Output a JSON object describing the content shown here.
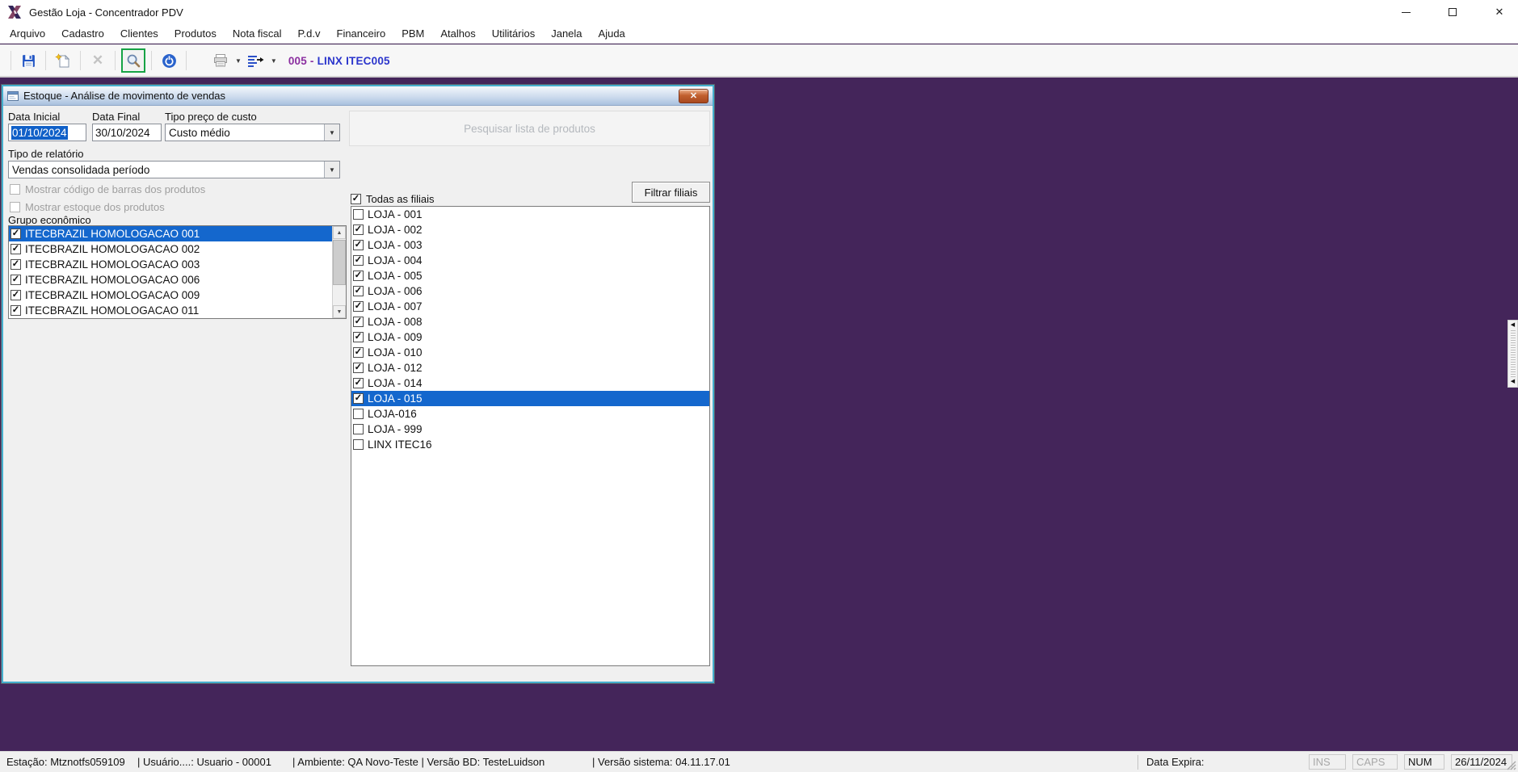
{
  "window": {
    "title": "Gestão Loja - Concentrador PDV"
  },
  "menu": {
    "items": [
      "Arquivo",
      "Cadastro",
      "Clientes",
      "Produtos",
      "Nota fiscal",
      "P.d.v",
      "Financeiro",
      "PBM",
      "Atalhos",
      "Utilitários",
      "Janela",
      "Ajuda"
    ]
  },
  "toolbar": {
    "store_prefix": "005 - ",
    "store_name": "LINX ITEC005"
  },
  "dialog": {
    "title": "Estoque - Análise de movimento de vendas",
    "fields": {
      "data_inicial": {
        "label": "Data Inicial",
        "value": "01/10/2024"
      },
      "data_final": {
        "label": "Data Final",
        "value": "30/10/2024"
      },
      "tipo_preco": {
        "label": "Tipo preço de custo",
        "value": "Custo médio"
      },
      "tipo_relatorio": {
        "label": "Tipo de relatório",
        "value": "Vendas consolidada período"
      }
    },
    "buttons": {
      "pesquisar": "Pesquisar lista de produtos",
      "filtrar": "Filtrar filiais"
    },
    "checkboxes": {
      "mostrar_codigo": {
        "label": "Mostrar código de barras dos produtos",
        "checked": false
      },
      "mostrar_estoque": {
        "label": "Mostrar estoque dos produtos",
        "checked": false
      },
      "todas_filiais": {
        "label": "Todas as filiais",
        "checked": true
      }
    },
    "grupo_economico": {
      "label": "Grupo econômico",
      "items": [
        {
          "label": "ITECBRAZIL HOMOLOGACAO 001",
          "checked": true,
          "selected": true
        },
        {
          "label": "ITECBRAZIL HOMOLOGACAO 002",
          "checked": true
        },
        {
          "label": "ITECBRAZIL HOMOLOGACAO 003",
          "checked": true
        },
        {
          "label": "ITECBRAZIL HOMOLOGACAO 006",
          "checked": true
        },
        {
          "label": "ITECBRAZIL HOMOLOGACAO 009",
          "checked": true
        },
        {
          "label": "ITECBRAZIL HOMOLOGACAO 011",
          "checked": true
        }
      ]
    },
    "filiais": {
      "items": [
        {
          "label": "LOJA - 001",
          "checked": false
        },
        {
          "label": "LOJA - 002",
          "checked": true
        },
        {
          "label": "LOJA - 003",
          "checked": true
        },
        {
          "label": "LOJA - 004",
          "checked": true
        },
        {
          "label": "LOJA - 005",
          "checked": true
        },
        {
          "label": "LOJA - 006",
          "checked": true
        },
        {
          "label": "LOJA - 007",
          "checked": true
        },
        {
          "label": "LOJA - 008",
          "checked": true
        },
        {
          "label": "LOJA - 009",
          "checked": true
        },
        {
          "label": "LOJA - 010",
          "checked": true
        },
        {
          "label": "LOJA - 012",
          "checked": true
        },
        {
          "label": "LOJA - 014",
          "checked": true
        },
        {
          "label": "LOJA - 015",
          "checked": true,
          "selected": true
        },
        {
          "label": "LOJA-016",
          "checked": false
        },
        {
          "label": "LOJA - 999",
          "checked": false
        },
        {
          "label": "LINX ITEC16",
          "checked": false
        }
      ]
    }
  },
  "statusbar": {
    "estacao": "Estação: Mtznotfs059109",
    "usuario": "| Usuário....: Usuario - 00001",
    "ambiente": "| Ambiente: QA Novo-Teste | Versão BD: TesteLuidson",
    "versao": "| Versão sistema: 04.11.17.01",
    "data_expira": "Data Expira:",
    "ins": "INS",
    "caps": "CAPS",
    "num": "NUM",
    "date": "26/11/2024"
  },
  "icons": {
    "check": "✓",
    "combo_arrow": "▼",
    "scroll_up": "▲",
    "scroll_down": "▼",
    "dock_left": "◀",
    "close": "✕",
    "minimize": "—"
  },
  "colors": {
    "workspace_purple": "#44255a",
    "selection_blue": "#1467cd",
    "search_highlight_green": "#17a345",
    "dialog_border_cyan": "#45afce",
    "close_button_orange": "#c2602f",
    "station_prefix_purple": "#8b2fa0",
    "station_name_blue": "#2b35cc"
  }
}
